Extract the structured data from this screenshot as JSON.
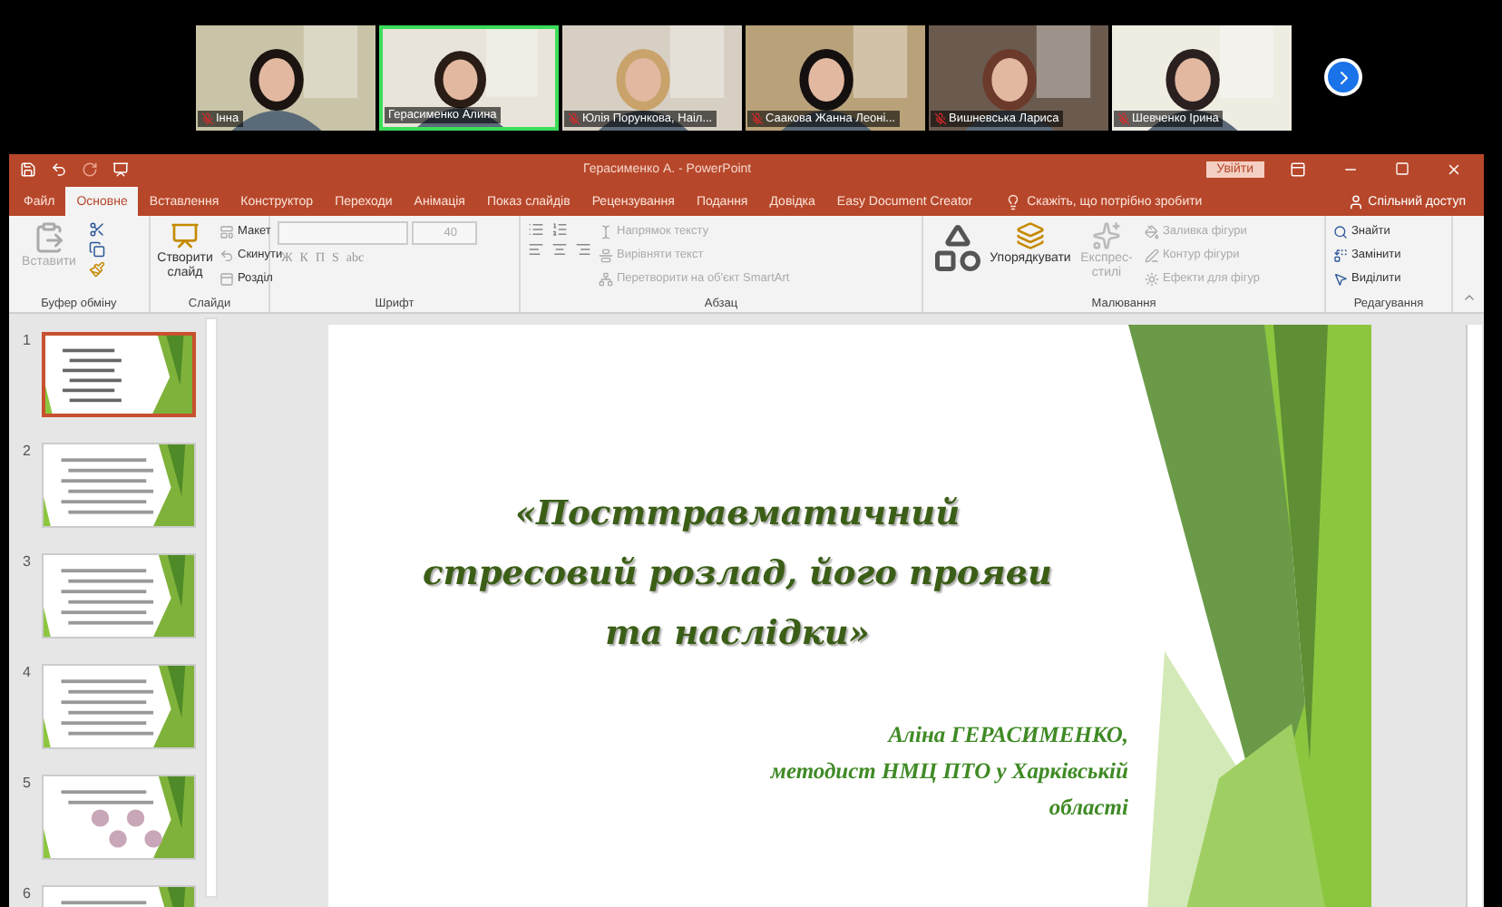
{
  "participants": [
    {
      "name": "Інна",
      "muted": true,
      "speaking": false
    },
    {
      "name": "Герасименко Алина",
      "muted": false,
      "speaking": true
    },
    {
      "name": "Юлія Порункова, Наіл...",
      "muted": true,
      "speaking": false
    },
    {
      "name": "Саакова Жанна Леоні...",
      "muted": true,
      "speaking": false
    },
    {
      "name": "Вишневська Лариса",
      "muted": true,
      "speaking": false
    },
    {
      "name": "Шевченко Ірина",
      "muted": true,
      "speaking": false
    }
  ],
  "window": {
    "title": "Герасименко А.  -  PowerPoint",
    "signin": "Увійти"
  },
  "tabs": [
    {
      "label": "Файл",
      "selected": false
    },
    {
      "label": "Основне",
      "selected": true
    },
    {
      "label": "Вставлення",
      "selected": false
    },
    {
      "label": "Конструктор",
      "selected": false
    },
    {
      "label": "Переходи",
      "selected": false
    },
    {
      "label": "Анімація",
      "selected": false
    },
    {
      "label": "Показ слайдів",
      "selected": false
    },
    {
      "label": "Рецензування",
      "selected": false
    },
    {
      "label": "Подання",
      "selected": false
    },
    {
      "label": "Довідка",
      "selected": false
    },
    {
      "label": "Easy Document Creator",
      "selected": false
    }
  ],
  "tell_me": "Скажіть, що потрібно зробити",
  "share": "Спільний доступ",
  "ribbon_groups": [
    {
      "kind": "clipboard",
      "label": "Буфер обміну",
      "items": [
        {
          "kind": "big",
          "label": "Вставити",
          "disabled": true
        }
      ]
    },
    {
      "kind": "slides",
      "label": "Слайди",
      "items": [
        {
          "kind": "big",
          "label": "Створити слайд",
          "disabled": false
        },
        {
          "kind": "small",
          "label": "Макет",
          "disabled": false
        },
        {
          "kind": "small",
          "label": "Скинути",
          "disabled": false
        },
        {
          "kind": "small",
          "label": "Розділ",
          "disabled": false
        }
      ]
    },
    {
      "kind": "font",
      "label": "Шрифт",
      "size": "40",
      "format_buttons": [
        "Ж",
        "К",
        "П",
        "S",
        "abc"
      ]
    },
    {
      "kind": "paragraph",
      "label": "Абзац",
      "items": [
        {
          "kind": "small",
          "label": "Напрямок тексту",
          "disabled": true
        },
        {
          "kind": "small",
          "label": "Вирівняти текст",
          "disabled": true
        },
        {
          "kind": "small",
          "label": "Перетворити на об'єкт SmartArt",
          "disabled": true
        }
      ]
    },
    {
      "kind": "drawing",
      "label": "Малювання",
      "items": [
        {
          "kind": "big",
          "label": "Упорядкувати",
          "disabled": false
        },
        {
          "kind": "big",
          "label": "Експрес-стилі",
          "disabled": true
        },
        {
          "kind": "small",
          "label": "Заливка фігури",
          "disabled": true
        },
        {
          "kind": "small",
          "label": "Контур фігури",
          "disabled": true
        },
        {
          "kind": "small",
          "label": "Ефекти для фігур",
          "disabled": true
        }
      ]
    },
    {
      "kind": "editing",
      "label": "Редагування",
      "items": [
        {
          "kind": "small",
          "label": "Знайти",
          "disabled": false
        },
        {
          "kind": "small",
          "label": "Замінити",
          "disabled": false
        },
        {
          "kind": "small",
          "label": "Виділити",
          "disabled": false
        }
      ]
    }
  ],
  "slides": [
    {
      "number": "1",
      "selected": true
    },
    {
      "number": "2",
      "selected": false
    },
    {
      "number": "3",
      "selected": false
    },
    {
      "number": "4",
      "selected": false
    },
    {
      "number": "5",
      "selected": false
    },
    {
      "number": "6",
      "selected": false
    }
  ],
  "slide": {
    "title_lines": [
      "«Посттравматичний",
      "стресовий розлад, його прояви",
      "та наслідки»"
    ],
    "author_lines": [
      "Аліна ГЕРАСИМЕНКО,",
      "методист НМЦ ПТО у Харківській",
      "області"
    ]
  }
}
